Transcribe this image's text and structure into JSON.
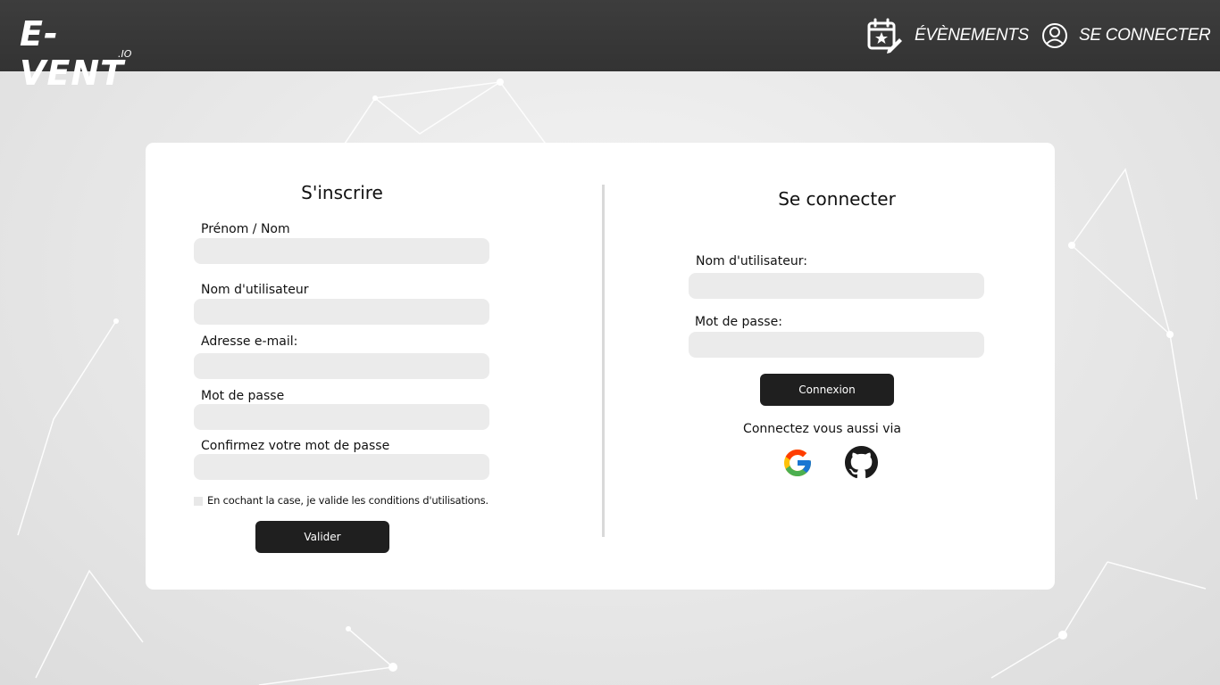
{
  "header": {
    "logo_text": "E-VENT",
    "logo_sub": ".IO",
    "nav": {
      "events_label": "ÉVÈNEMENTS",
      "events_icon": "calendar-star-edit-icon",
      "login_label": "SE CONNECTER",
      "login_icon": "user-circle-icon"
    }
  },
  "register": {
    "title": "S'inscrire",
    "fields": [
      {
        "label": "Prénom / Nom",
        "value": "",
        "placeholder": ""
      },
      {
        "label": "Nom d'utilisateur",
        "value": "",
        "placeholder": ""
      },
      {
        "label": "Adresse e-mail:",
        "value": "",
        "placeholder": ""
      },
      {
        "label": "Mot de passe",
        "value": "",
        "placeholder": ""
      },
      {
        "label": "Confirmez votre mot de passe",
        "value": "",
        "placeholder": ""
      }
    ],
    "terms_label": "En cochant la case, je valide les conditions d'utilisations.",
    "submit_label": "Valider"
  },
  "login": {
    "title": "Se connecter",
    "fields": [
      {
        "label": "Nom d'utilisateur:",
        "value": "",
        "placeholder": ""
      },
      {
        "label": "Mot de passe:",
        "value": "",
        "placeholder": ""
      }
    ],
    "submit_label": "Connexion",
    "via_label": "Connectez vous aussi via",
    "providers": [
      "google-icon",
      "github-icon"
    ]
  },
  "colors": {
    "header_bg": "#383838",
    "button_bg": "#1f1f1f",
    "input_bg": "#ebebeb"
  }
}
